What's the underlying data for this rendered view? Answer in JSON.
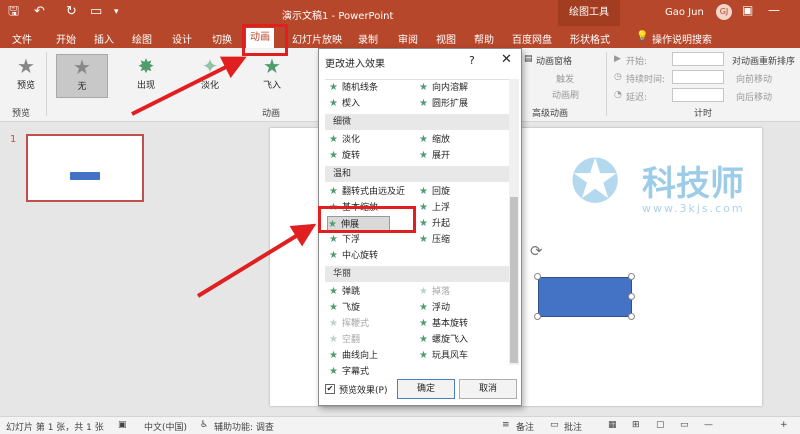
{
  "titlebar": {
    "title": "演示文稿1 - PowerPoint",
    "tools": "绘图工具",
    "user": "Gao Jun",
    "initials": "GJ"
  },
  "tabs": [
    "文件",
    "开始",
    "插入",
    "绘图",
    "设计",
    "切换",
    "动画",
    "幻灯片放映",
    "录制",
    "审阅",
    "视图",
    "帮助",
    "百度网盘",
    "形状格式",
    "操作说明搜索"
  ],
  "ribbon": {
    "preview_button": "预览",
    "preview_group": "预览",
    "effects": [
      "无",
      "出现",
      "淡化",
      "飞入"
    ],
    "animation_group": "动画",
    "animation_pane": "动画窗格",
    "trigger": "触发",
    "brush": "动画刷",
    "advanced_group": "高级动画",
    "start_label": "开始:",
    "duration_label": "持续时间:",
    "delay_label": "延迟:",
    "reorder_title": "对动画重新排序",
    "move_earlier": "向前移动",
    "move_later": "向后移动",
    "timing_group": "计时"
  },
  "thumbnail": {
    "number": "1"
  },
  "dialog": {
    "title": "更改进入效果",
    "help": "?",
    "close": "✕",
    "rows": [
      {
        "left": "随机线条",
        "right": "向内溶解"
      },
      {
        "left": "楔入",
        "right": "圆形扩展"
      }
    ],
    "category_subtle": "细微",
    "subtle_rows": [
      {
        "left": "淡化",
        "right": "缩放"
      },
      {
        "left": "旋转",
        "right": "展开"
      }
    ],
    "category_moderate": "温和",
    "moderate_rows": [
      {
        "left": "翻转式由远及近",
        "right": "回旋"
      },
      {
        "left": "基本缩放",
        "right": "上浮"
      },
      {
        "left": "伸展",
        "right": "升起"
      },
      {
        "left": "下浮",
        "right": "压缩"
      },
      {
        "left": "中心旋转",
        "right": ""
      }
    ],
    "category_exciting": "华丽",
    "exciting_rows": [
      {
        "left": "弹跳",
        "right": "掉落"
      },
      {
        "left": "飞旋",
        "right": "浮动"
      },
      {
        "left": "挥鞭式",
        "right": "基本旋转"
      },
      {
        "left": "空翻",
        "right": "螺旋飞入"
      },
      {
        "left": "曲线向上",
        "right": "玩具风车"
      },
      {
        "left": "字幕式",
        "right": ""
      }
    ],
    "preview_effect": "预览效果(P)",
    "ok": "确定",
    "cancel": "取消"
  },
  "watermark": {
    "text": "科技师",
    "url": "www.3kjs.com"
  },
  "status": {
    "slide_info": "幻灯片 第 1 张，共 1 张",
    "language": "中文(中国)",
    "accessibility": "辅助功能: 调查",
    "notes": "备注",
    "comments": "批注"
  },
  "colors": {
    "accent": "#b7472a",
    "shape": "#4472c4",
    "highlight": "#e02020"
  }
}
